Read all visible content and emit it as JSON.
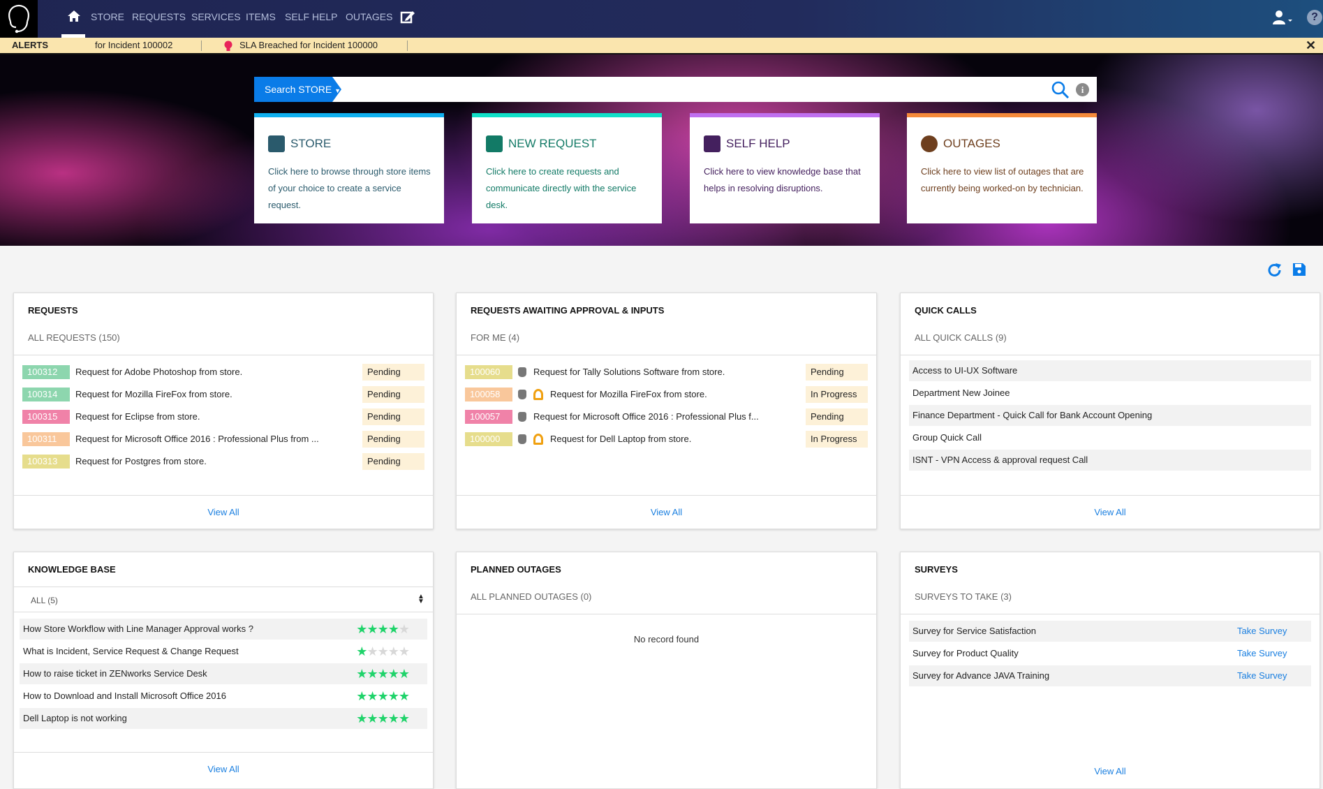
{
  "nav": {
    "items": [
      "STORE",
      "REQUESTS",
      "SERVICES",
      "ITEMS",
      "SELF HELP",
      "OUTAGES"
    ]
  },
  "alerts": {
    "label": "ALERTS",
    "items": [
      "for Incident 100002",
      "SLA Breached for Incident 100000"
    ]
  },
  "search": {
    "button": "Search STORE"
  },
  "cards": [
    {
      "title": "STORE",
      "text": "Click here to browse through store items of your choice to create a service request.",
      "color": "#10b0f0",
      "fg": "#2a5a6c"
    },
    {
      "title": "NEW REQUEST",
      "text": "Click here to create requests and communicate directly with the service desk.",
      "color": "#10e0c8",
      "fg": "#127a66"
    },
    {
      "title": "SELF HELP",
      "text": "Click here to view knowledge base that helps in resolving disruptions.",
      "color": "#c070f0",
      "fg": "#44205e"
    },
    {
      "title": "OUTAGES",
      "text": "Click here to view list of outages that are currently being worked-on by technician.",
      "color": "#f58a3a",
      "fg": "#6e3f1e"
    }
  ],
  "requests": {
    "title": "REQUESTS",
    "sub": "ALL REQUESTS (150)",
    "view_all": "View All",
    "rows": [
      {
        "id": "100312",
        "text": "Request for Adobe Photoshop from store.",
        "status": "Pending",
        "color": "#8dd6ae"
      },
      {
        "id": "100314",
        "text": "Request for Mozilla FireFox from store.",
        "status": "Pending",
        "color": "#8dd6ae"
      },
      {
        "id": "100315",
        "text": "Request for Eclipse from store.",
        "status": "Pending",
        "color": "#f082a8"
      },
      {
        "id": "100311",
        "text": "Request for Microsoft Office 2016 : Professional Plus from ...",
        "status": "Pending",
        "color": "#f9c79b"
      },
      {
        "id": "100313",
        "text": "Request for Postgres from store.",
        "status": "Pending",
        "color": "#e6dd8c"
      }
    ]
  },
  "approvals": {
    "title": "REQUESTS AWAITING APPROVAL & INPUTS",
    "sub": "FOR ME (4)",
    "view_all": "View All",
    "rows": [
      {
        "id": "100060",
        "text": "Request for Tally Solutions Software from store.",
        "status": "Pending",
        "color": "#e6dd8c",
        "clock": false
      },
      {
        "id": "100058",
        "text": "Request for Mozilla FireFox from store.",
        "status": "In Progress",
        "color": "#f9c79b",
        "clock": true
      },
      {
        "id": "100057",
        "text": "Request for Microsoft Office 2016 : Professional Plus f...",
        "status": "Pending",
        "color": "#f082a8",
        "clock": false
      },
      {
        "id": "100000",
        "text": "Request for Dell Laptop from store.",
        "status": "In Progress",
        "color": "#e6dd8c",
        "clock": true
      }
    ]
  },
  "quick_calls": {
    "title": "QUICK CALLS",
    "sub": "ALL QUICK CALLS (9)",
    "view_all": "View All",
    "rows": [
      "Access to UI-UX Software",
      "Department New Joinee",
      "Finance Department - Quick Call for Bank Account Opening",
      "Group Quick Call",
      "ISNT - VPN Access & approval request Call"
    ]
  },
  "knowledge": {
    "title": "KNOWLEDGE BASE",
    "filter": "ALL (5)",
    "view_all": "View All",
    "rows": [
      {
        "text": "How Store Workflow with Line Manager Approval works ?",
        "rating": 4
      },
      {
        "text": "What is Incident, Service Request & Change Request",
        "rating": 1
      },
      {
        "text": "How to raise ticket in ZENworks Service Desk",
        "rating": 5
      },
      {
        "text": "How to Download and Install Microsoft Office 2016",
        "rating": 5
      },
      {
        "text": "Dell Laptop is not working",
        "rating": 5
      }
    ]
  },
  "outages": {
    "title": "PLANNED OUTAGES",
    "sub": "ALL PLANNED OUTAGES (0)",
    "empty": "No record found"
  },
  "surveys": {
    "title": "SURVEYS",
    "sub": "SURVEYS TO TAKE (3)",
    "view_all": "View All",
    "action": "Take Survey",
    "rows": [
      "Survey for Service Satisfaction",
      "Survey for Product Quality",
      "Survey for Advance JAVA Training"
    ]
  }
}
